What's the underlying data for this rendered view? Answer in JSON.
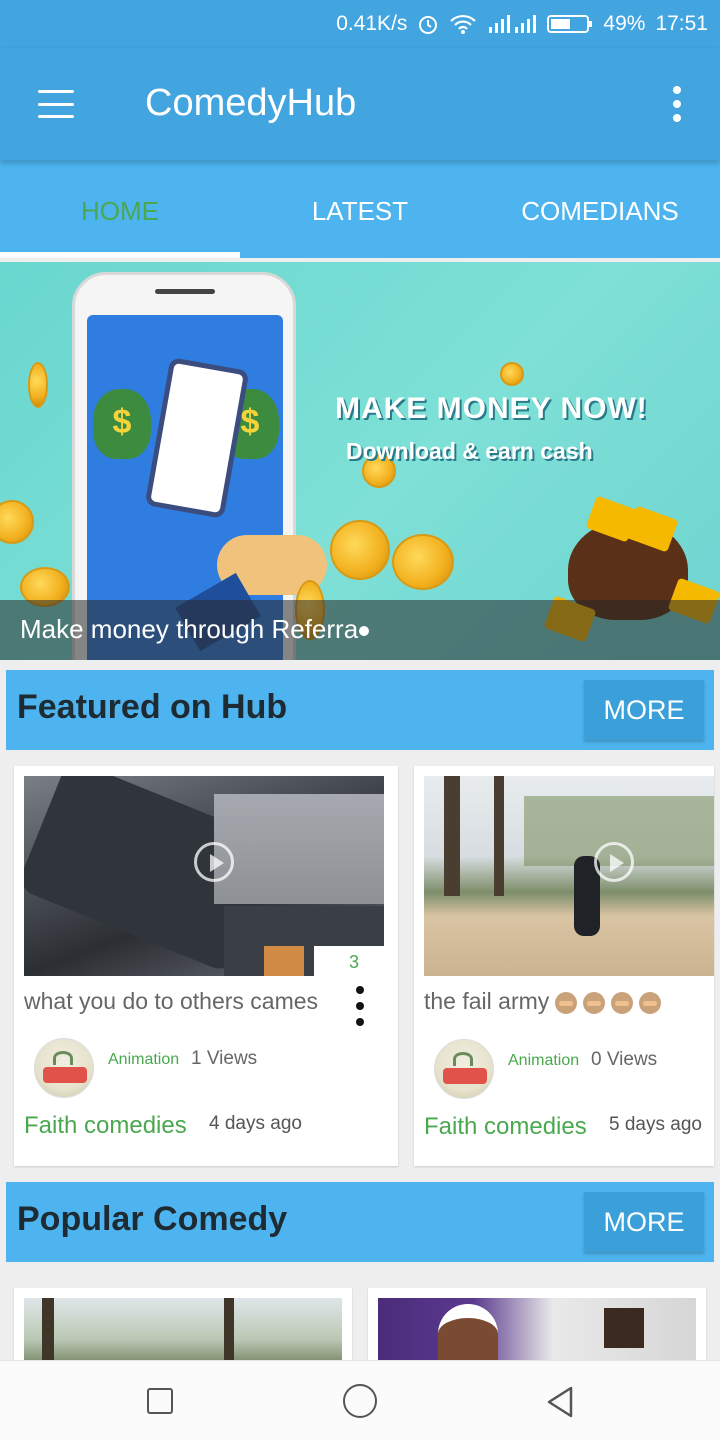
{
  "status_bar": {
    "speed": "0.41K/s",
    "battery": "49%",
    "time": "17:51"
  },
  "app_bar": {
    "title": "ComedyHub"
  },
  "tabs": [
    {
      "label": "HOME",
      "active": true
    },
    {
      "label": "LATEST",
      "active": false
    },
    {
      "label": "COMEDIANS",
      "active": false
    }
  ],
  "banner": {
    "headline": "MAKE MONEY NOW!",
    "subheadline": "Download & earn cash",
    "caption": "Make money through Referra"
  },
  "featured": {
    "title": "Featured on Hub",
    "more_label": "MORE",
    "cards": [
      {
        "title": "what you do to others cames",
        "count": "3",
        "category": "Animation",
        "views": "1 Views",
        "author": "Faith comedies",
        "time_ago": "4 days ago"
      },
      {
        "title": "the fail army",
        "category": "Animation",
        "views": "0 Views",
        "author": "Faith comedies",
        "time_ago": "5 days ago"
      }
    ]
  },
  "popular": {
    "title": "Popular Comedy",
    "more_label": "MORE"
  },
  "colors": {
    "primary": "#42a5e0",
    "tab_bar": "#4db4ef",
    "accent_green": "#4aa84e",
    "more_button": "#3ba0d9"
  },
  "icons": {
    "menu": "hamburger-menu-icon",
    "overflow": "vertical-dots-icon",
    "play": "play-circle-icon",
    "nav_recent": "square-icon",
    "nav_home": "circle-icon",
    "nav_back": "triangle-back-icon"
  }
}
